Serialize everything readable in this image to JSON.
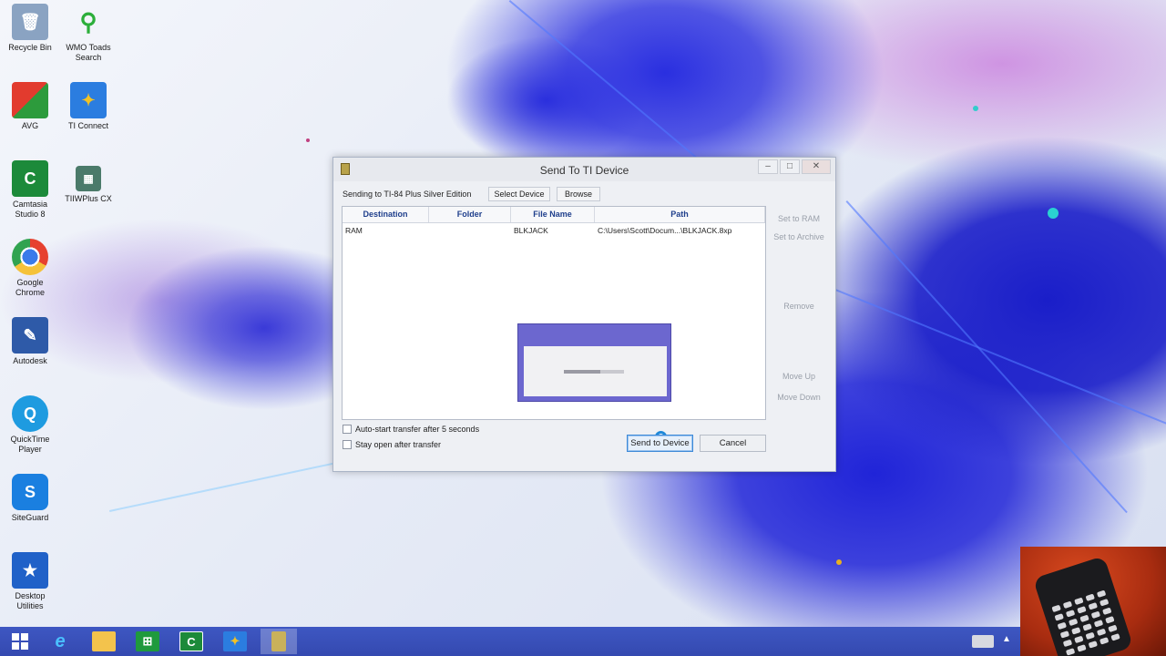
{
  "desktop": {
    "icons": [
      {
        "label": "Recycle Bin"
      },
      {
        "label": "WMO Toads Search"
      },
      {
        "label": "AVG"
      },
      {
        "label": "TI Connect"
      },
      {
        "label": "Camtasia Studio 8"
      },
      {
        "label": "TIIWPlus CX"
      },
      {
        "label": "Google Chrome"
      },
      {
        "label": "Autodesk"
      },
      {
        "label": "QuickTime Player"
      },
      {
        "label": "SiteGuard"
      },
      {
        "label": "Desktop Utilities"
      }
    ]
  },
  "dialog": {
    "title": "Send To TI Device",
    "sending_label": "Sending to TI-84 Plus Silver Edition",
    "select_device_label": "Select Device",
    "browse_label": "Browse",
    "table": {
      "headers": [
        "Destination",
        "Folder",
        "File Name",
        "Path"
      ],
      "rows": [
        {
          "destination": "RAM",
          "folder": "",
          "file_name": "BLKJACK",
          "path": "C:\\Users\\Scott\\Docum...\\BLKJACK.8xp"
        }
      ]
    },
    "side_buttons": {
      "set_to_ram": "Set to RAM",
      "set_to_archive": "Set to Archive",
      "remove": "Remove",
      "move_up": "Move Up",
      "move_down": "Move Down"
    },
    "autostart_label": "Auto-start transfer after 5 seconds",
    "stay_open_label": "Stay open after transfer",
    "send_label": "Send to Device",
    "cancel_label": "Cancel",
    "progress_fraction": 0.6
  },
  "taskbar": {
    "items": [
      "start-icon",
      "internet-explorer-icon",
      "file-explorer-icon",
      "store-icon",
      "camtasia-icon",
      "ti-connect-icon",
      "send-to-device-icon"
    ]
  },
  "colors": {
    "taskbar": "#3449b0",
    "popup": "#6c67cf",
    "header_text": "#1f3f8c"
  }
}
